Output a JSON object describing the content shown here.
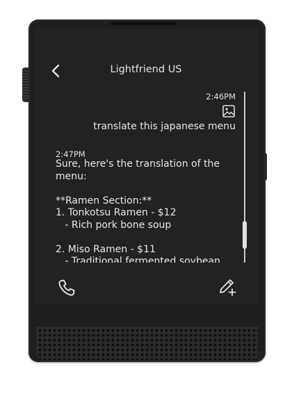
{
  "header": {
    "title": "Lightfriend US",
    "back_icon": "chevron-left-icon"
  },
  "messages": [
    {
      "role": "user",
      "time": "2:46PM",
      "attachment_icon": "image-icon",
      "text": "translate this japanese menu"
    },
    {
      "role": "assistant",
      "time": "2:47PM",
      "text": "Sure, here's the translation of the\nmenu:\n\n**Ramen Section:**\n1. Tonkotsu Ramen - $12\n   - Rich pork bone soup\n\n2. Miso Ramen - $11\n   - Traditional fermented soybean\npaste soup"
    }
  ],
  "footer": {
    "call_icon": "phone-icon",
    "compose_icon": "compose-icon"
  },
  "colors": {
    "screen_bg": "#222222",
    "text": "#e9e3e9",
    "device_body": "#1e1e1e"
  }
}
